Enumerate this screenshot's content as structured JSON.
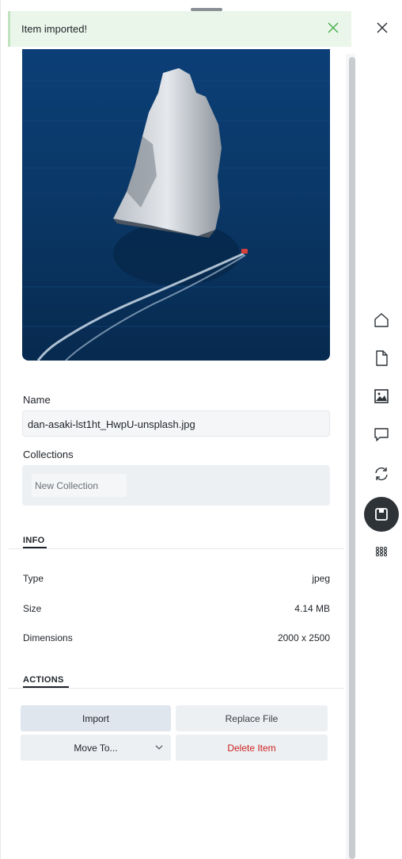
{
  "toast": {
    "message": "Item imported!"
  },
  "image": {
    "alt": "aerial view of sea stack and boat wake"
  },
  "details": {
    "name_label": "Name",
    "name_value": "dan-asaki-lst1ht_HwpU-unsplash.jpg",
    "collections_label": "Collections",
    "new_collection": "New Collection"
  },
  "info": {
    "title": "INFO",
    "rows": [
      {
        "key": "Type",
        "value": "jpeg"
      },
      {
        "key": "Size",
        "value": "4.14 MB"
      },
      {
        "key": "Dimensions",
        "value": "2000 x 2500"
      }
    ]
  },
  "actions": {
    "title": "ACTIONS",
    "import": "Import",
    "replace": "Replace File",
    "move": "Move To...",
    "delete": "Delete Item"
  },
  "rail": {
    "icons": [
      "home-icon",
      "file-icon",
      "image-icon",
      "comment-icon",
      "sync-icon",
      "save-icon",
      "apps-grid-icon"
    ],
    "active": "save-icon"
  },
  "colors": {
    "toast_bg": "#eaf6ea",
    "toast_icon": "#4caf50",
    "delete": "#cc1f1f",
    "active_rail": "#2e3338"
  }
}
